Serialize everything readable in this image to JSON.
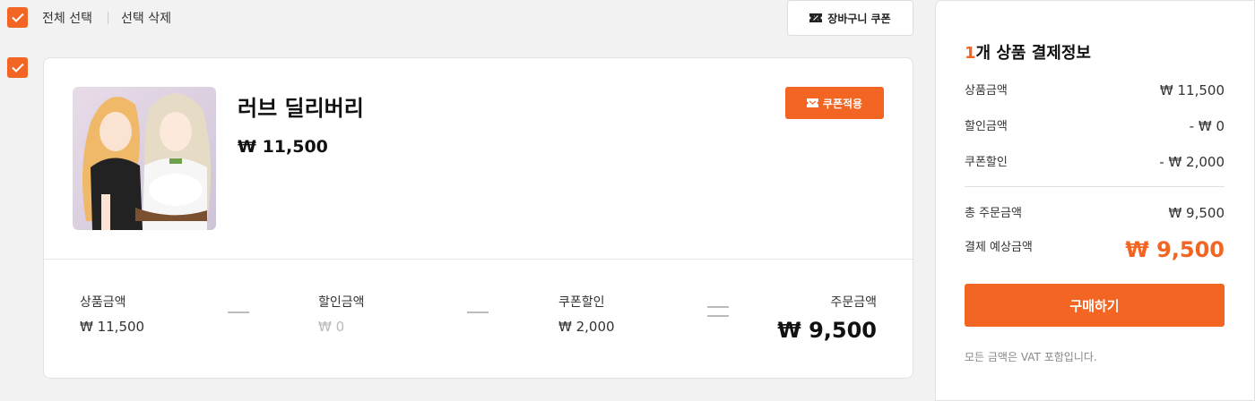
{
  "toolbar": {
    "select_all_label": "전체 선택",
    "delete_selected_label": "선택 삭제",
    "cart_coupon_label": "장바구니 쿠폰"
  },
  "product": {
    "name": "러브 딜리버리",
    "price": "₩ 11,500",
    "coupon_apply_label": "쿠폰적용",
    "thumbnail_icon": "product-artwork"
  },
  "summary": {
    "items": [
      {
        "label": "상품금액",
        "value": "₩ 11,500"
      },
      {
        "label": "할인금액",
        "value": "₩ 0"
      },
      {
        "label": "쿠폰할인",
        "value": "₩ 2,000"
      }
    ],
    "total_label": "주문금액",
    "total_value": "₩ 9,500"
  },
  "panel": {
    "title_count": "1",
    "title_text": "개 상품 결제정보",
    "rows": [
      {
        "label": "상품금액",
        "value": "₩ 11,500"
      },
      {
        "label": "할인금액",
        "value": "- ₩ 0"
      },
      {
        "label": "쿠폰할인",
        "value": "- ₩ 2,000"
      }
    ],
    "total_order_label": "총 주문금액",
    "total_order_value": "₩ 9,500",
    "expected_label": "결제 예상금액",
    "expected_value": "₩ 9,500",
    "buy_label": "구매하기",
    "vat_note": "모든 금액은 VAT 포함입니다."
  },
  "colors": {
    "accent": "#f26522",
    "background": "#f2f2f2"
  }
}
